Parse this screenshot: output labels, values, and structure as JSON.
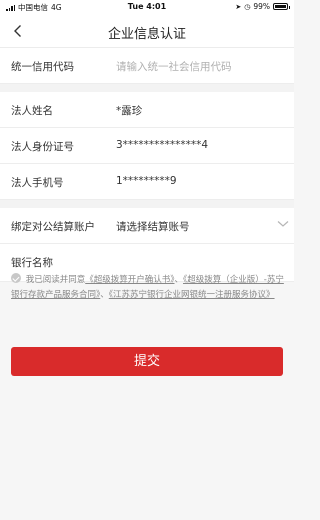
{
  "status_bar": {
    "carrier": "中国电信",
    "network": "4G",
    "time": "Tue 4:01",
    "battery_pct": "99%"
  },
  "nav": {
    "title": "企业信息认证"
  },
  "form": {
    "credit_code": {
      "label": "统一信用代码",
      "placeholder": "请输入统一社会信用代码"
    },
    "legal_name": {
      "label": "法人姓名",
      "value": "*露珍"
    },
    "legal_id": {
      "label": "法人身份证号",
      "value": "3***************4"
    },
    "legal_phone": {
      "label": "法人手机号",
      "value": "1*********9"
    },
    "bind_account": {
      "label": "绑定对公结算账户",
      "placeholder": "请选择结算账号"
    },
    "bank_name": {
      "label": "银行名称"
    }
  },
  "agreement": {
    "prefix": "我已阅读并同意",
    "doc1": "《超级拨算开户确认书》",
    "sep1": "、",
    "doc2": "《超级拨算（企业版）-苏宁银行存款产品服务合同》",
    "sep2": "、",
    "doc3": "《江苏苏宁银行企业网银统一注册服务协议》"
  },
  "submit_label": "提交",
  "colors": {
    "accent": "#d92b2b",
    "background": "#f6f6f6"
  }
}
